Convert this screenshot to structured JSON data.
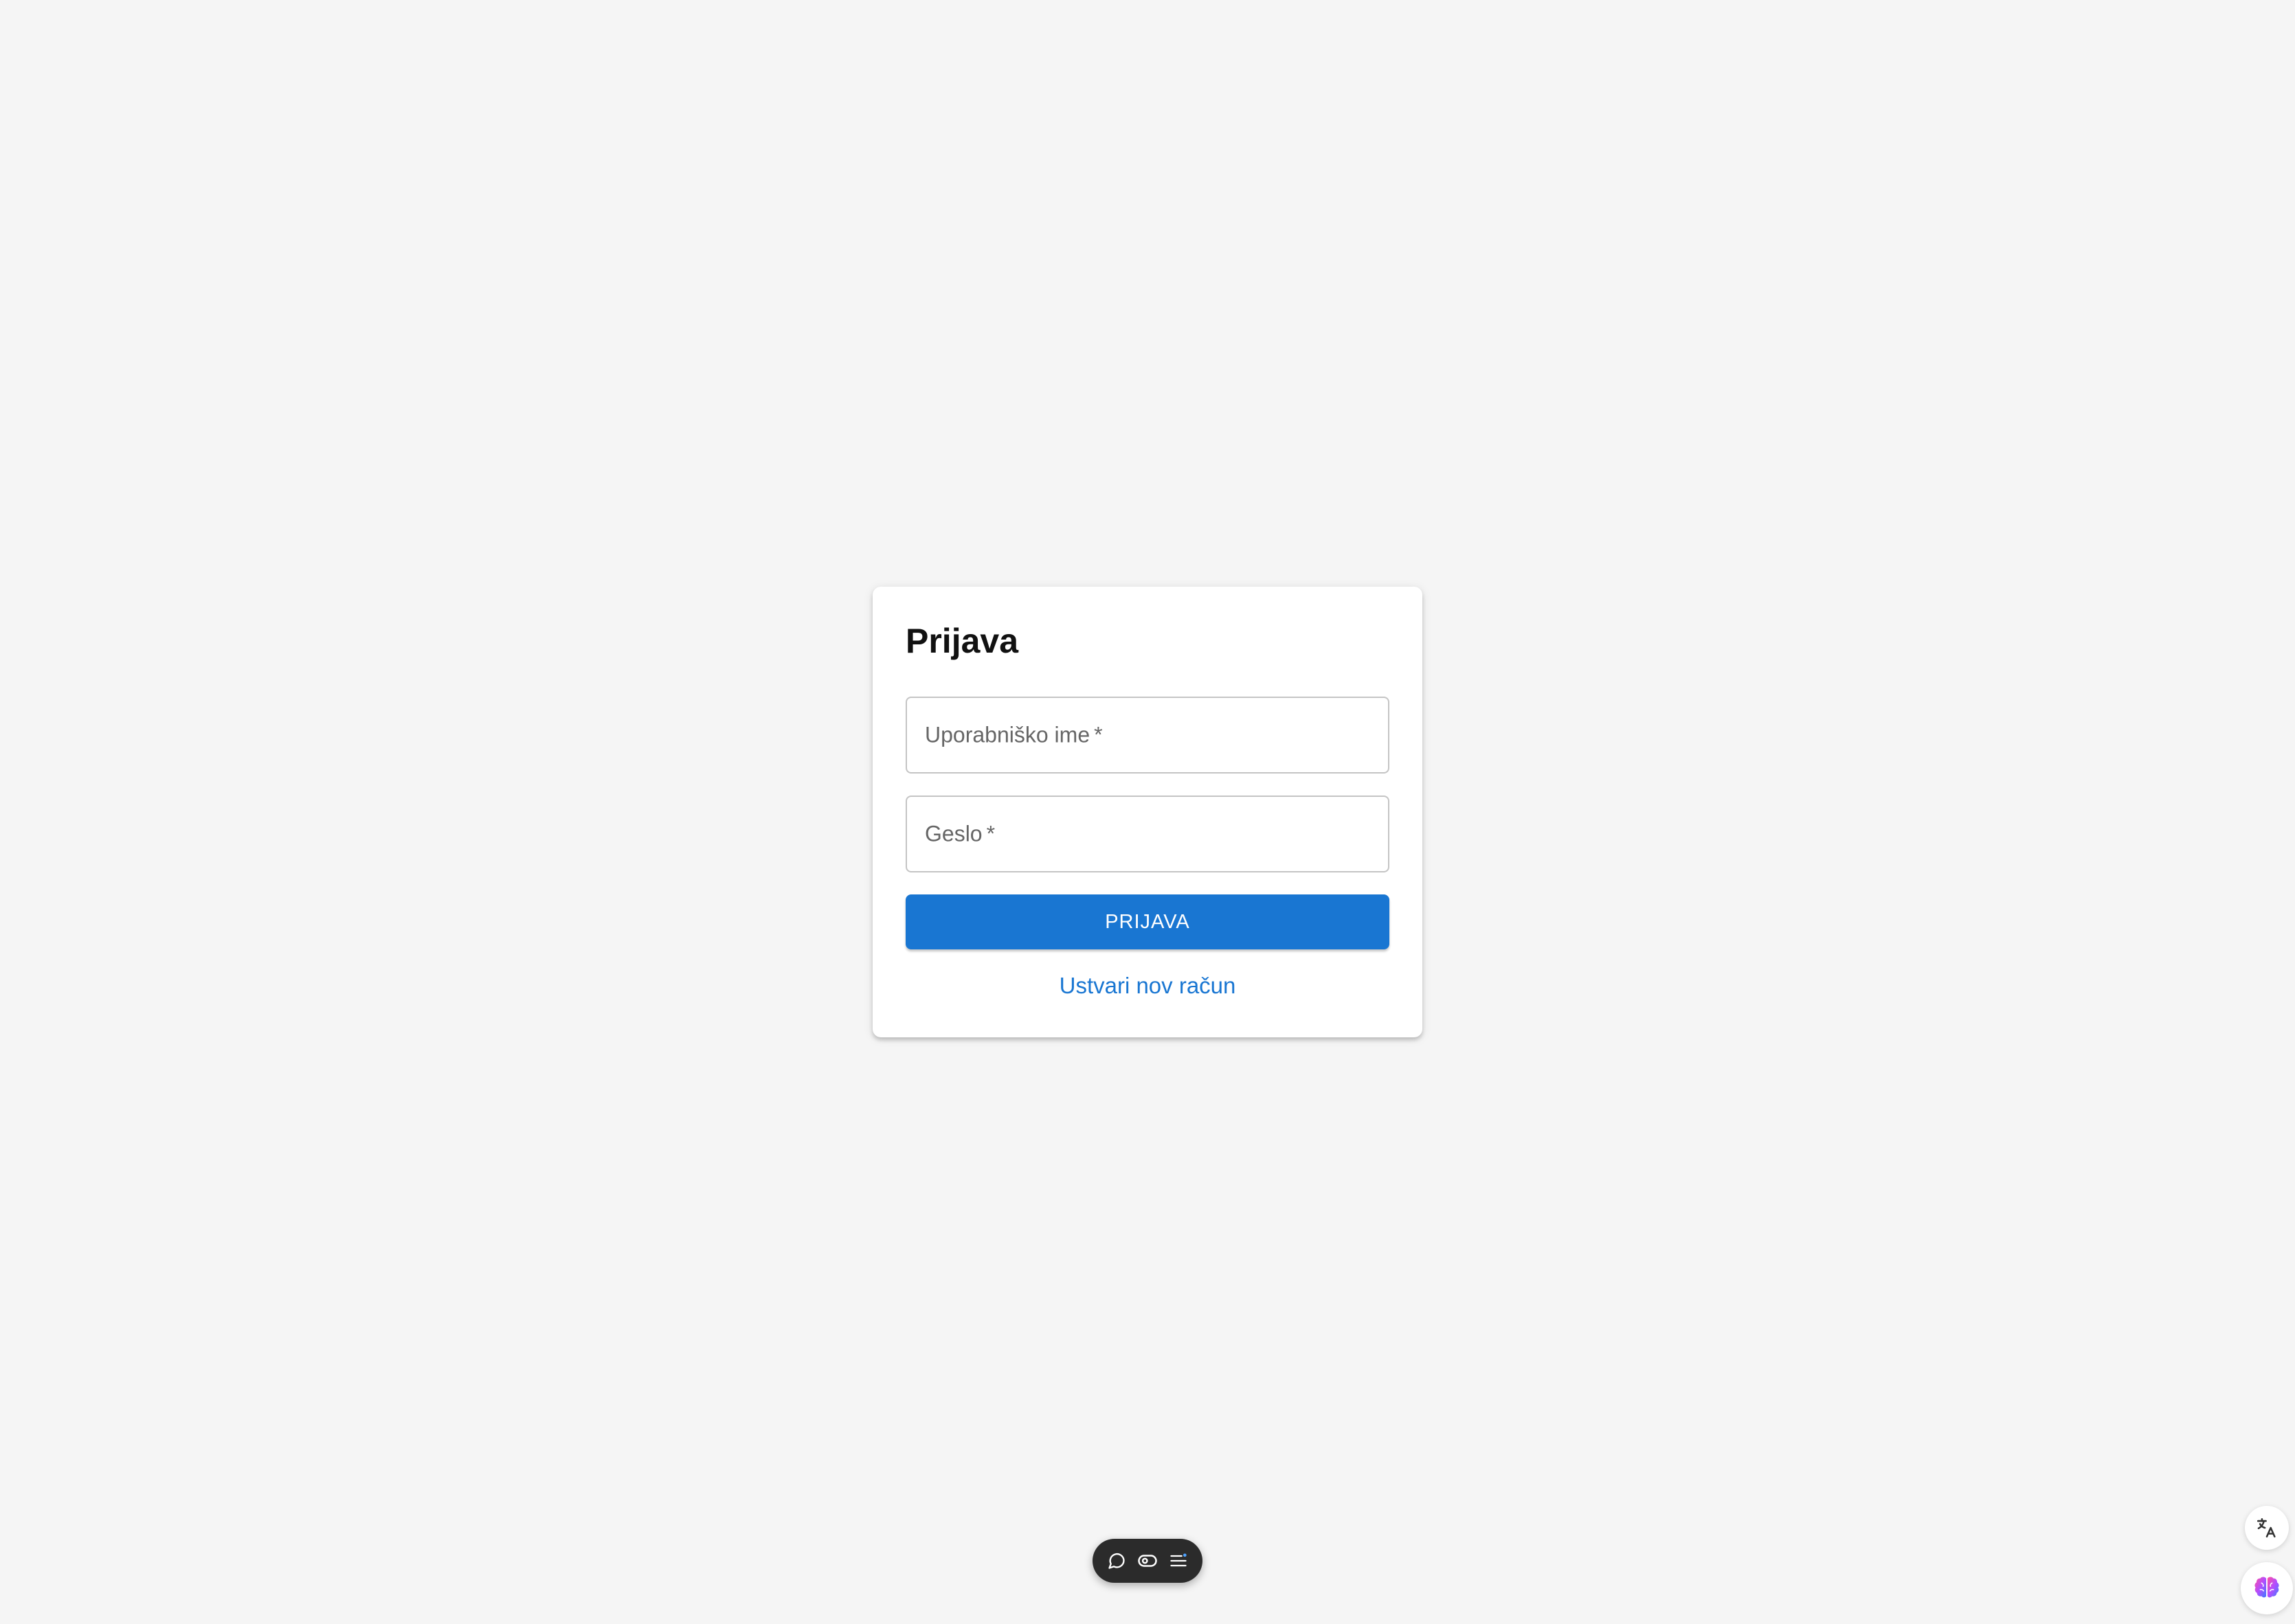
{
  "login": {
    "title": "Prijava",
    "username_label": "Uporabniško ime",
    "password_label": "Geslo",
    "required_marker": "*",
    "submit_label": "PRIJAVA",
    "register_link": "Ustvari nov račun"
  },
  "toolbar": {
    "icons": [
      "comment-icon",
      "eye-icon",
      "list-icon"
    ]
  },
  "side_buttons": {
    "icons": [
      "translate-icon",
      "brain-icon"
    ]
  },
  "colors": {
    "background": "#f5f5f5",
    "primary": "#1976d2",
    "toolbar": "#2b2b2b"
  }
}
